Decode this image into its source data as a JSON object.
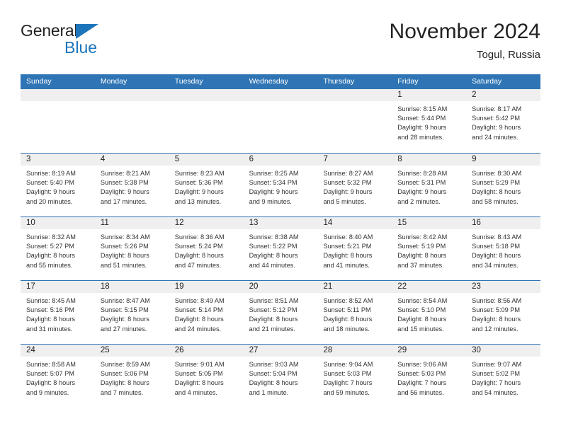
{
  "brand": {
    "name_part1": "General",
    "name_part2": "Blue",
    "mark": "triangle-icon"
  },
  "header": {
    "title": "November 2024",
    "subtitle": "Togul, Russia"
  },
  "calendar": {
    "weekday_headers": [
      "Sunday",
      "Monday",
      "Tuesday",
      "Wednesday",
      "Thursday",
      "Friday",
      "Saturday"
    ],
    "colors": {
      "header_blue": "#2f75b5",
      "day_band_gray": "#efefef",
      "text": "#333333"
    },
    "weeks": [
      [
        {
          "day": "",
          "sunrise": "",
          "sunset": "",
          "daylight_line1": "",
          "daylight_line2": ""
        },
        {
          "day": "",
          "sunrise": "",
          "sunset": "",
          "daylight_line1": "",
          "daylight_line2": ""
        },
        {
          "day": "",
          "sunrise": "",
          "sunset": "",
          "daylight_line1": "",
          "daylight_line2": ""
        },
        {
          "day": "",
          "sunrise": "",
          "sunset": "",
          "daylight_line1": "",
          "daylight_line2": ""
        },
        {
          "day": "",
          "sunrise": "",
          "sunset": "",
          "daylight_line1": "",
          "daylight_line2": ""
        },
        {
          "day": "1",
          "sunrise": "Sunrise: 8:15 AM",
          "sunset": "Sunset: 5:44 PM",
          "daylight_line1": "Daylight: 9 hours",
          "daylight_line2": "and 28 minutes."
        },
        {
          "day": "2",
          "sunrise": "Sunrise: 8:17 AM",
          "sunset": "Sunset: 5:42 PM",
          "daylight_line1": "Daylight: 9 hours",
          "daylight_line2": "and 24 minutes."
        }
      ],
      [
        {
          "day": "3",
          "sunrise": "Sunrise: 8:19 AM",
          "sunset": "Sunset: 5:40 PM",
          "daylight_line1": "Daylight: 9 hours",
          "daylight_line2": "and 20 minutes."
        },
        {
          "day": "4",
          "sunrise": "Sunrise: 8:21 AM",
          "sunset": "Sunset: 5:38 PM",
          "daylight_line1": "Daylight: 9 hours",
          "daylight_line2": "and 17 minutes."
        },
        {
          "day": "5",
          "sunrise": "Sunrise: 8:23 AM",
          "sunset": "Sunset: 5:36 PM",
          "daylight_line1": "Daylight: 9 hours",
          "daylight_line2": "and 13 minutes."
        },
        {
          "day": "6",
          "sunrise": "Sunrise: 8:25 AM",
          "sunset": "Sunset: 5:34 PM",
          "daylight_line1": "Daylight: 9 hours",
          "daylight_line2": "and 9 minutes."
        },
        {
          "day": "7",
          "sunrise": "Sunrise: 8:27 AM",
          "sunset": "Sunset: 5:32 PM",
          "daylight_line1": "Daylight: 9 hours",
          "daylight_line2": "and 5 minutes."
        },
        {
          "day": "8",
          "sunrise": "Sunrise: 8:28 AM",
          "sunset": "Sunset: 5:31 PM",
          "daylight_line1": "Daylight: 9 hours",
          "daylight_line2": "and 2 minutes."
        },
        {
          "day": "9",
          "sunrise": "Sunrise: 8:30 AM",
          "sunset": "Sunset: 5:29 PM",
          "daylight_line1": "Daylight: 8 hours",
          "daylight_line2": "and 58 minutes."
        }
      ],
      [
        {
          "day": "10",
          "sunrise": "Sunrise: 8:32 AM",
          "sunset": "Sunset: 5:27 PM",
          "daylight_line1": "Daylight: 8 hours",
          "daylight_line2": "and 55 minutes."
        },
        {
          "day": "11",
          "sunrise": "Sunrise: 8:34 AM",
          "sunset": "Sunset: 5:26 PM",
          "daylight_line1": "Daylight: 8 hours",
          "daylight_line2": "and 51 minutes."
        },
        {
          "day": "12",
          "sunrise": "Sunrise: 8:36 AM",
          "sunset": "Sunset: 5:24 PM",
          "daylight_line1": "Daylight: 8 hours",
          "daylight_line2": "and 47 minutes."
        },
        {
          "day": "13",
          "sunrise": "Sunrise: 8:38 AM",
          "sunset": "Sunset: 5:22 PM",
          "daylight_line1": "Daylight: 8 hours",
          "daylight_line2": "and 44 minutes."
        },
        {
          "day": "14",
          "sunrise": "Sunrise: 8:40 AM",
          "sunset": "Sunset: 5:21 PM",
          "daylight_line1": "Daylight: 8 hours",
          "daylight_line2": "and 41 minutes."
        },
        {
          "day": "15",
          "sunrise": "Sunrise: 8:42 AM",
          "sunset": "Sunset: 5:19 PM",
          "daylight_line1": "Daylight: 8 hours",
          "daylight_line2": "and 37 minutes."
        },
        {
          "day": "16",
          "sunrise": "Sunrise: 8:43 AM",
          "sunset": "Sunset: 5:18 PM",
          "daylight_line1": "Daylight: 8 hours",
          "daylight_line2": "and 34 minutes."
        }
      ],
      [
        {
          "day": "17",
          "sunrise": "Sunrise: 8:45 AM",
          "sunset": "Sunset: 5:16 PM",
          "daylight_line1": "Daylight: 8 hours",
          "daylight_line2": "and 31 minutes."
        },
        {
          "day": "18",
          "sunrise": "Sunrise: 8:47 AM",
          "sunset": "Sunset: 5:15 PM",
          "daylight_line1": "Daylight: 8 hours",
          "daylight_line2": "and 27 minutes."
        },
        {
          "day": "19",
          "sunrise": "Sunrise: 8:49 AM",
          "sunset": "Sunset: 5:14 PM",
          "daylight_line1": "Daylight: 8 hours",
          "daylight_line2": "and 24 minutes."
        },
        {
          "day": "20",
          "sunrise": "Sunrise: 8:51 AM",
          "sunset": "Sunset: 5:12 PM",
          "daylight_line1": "Daylight: 8 hours",
          "daylight_line2": "and 21 minutes."
        },
        {
          "day": "21",
          "sunrise": "Sunrise: 8:52 AM",
          "sunset": "Sunset: 5:11 PM",
          "daylight_line1": "Daylight: 8 hours",
          "daylight_line2": "and 18 minutes."
        },
        {
          "day": "22",
          "sunrise": "Sunrise: 8:54 AM",
          "sunset": "Sunset: 5:10 PM",
          "daylight_line1": "Daylight: 8 hours",
          "daylight_line2": "and 15 minutes."
        },
        {
          "day": "23",
          "sunrise": "Sunrise: 8:56 AM",
          "sunset": "Sunset: 5:09 PM",
          "daylight_line1": "Daylight: 8 hours",
          "daylight_line2": "and 12 minutes."
        }
      ],
      [
        {
          "day": "24",
          "sunrise": "Sunrise: 8:58 AM",
          "sunset": "Sunset: 5:07 PM",
          "daylight_line1": "Daylight: 8 hours",
          "daylight_line2": "and 9 minutes."
        },
        {
          "day": "25",
          "sunrise": "Sunrise: 8:59 AM",
          "sunset": "Sunset: 5:06 PM",
          "daylight_line1": "Daylight: 8 hours",
          "daylight_line2": "and 7 minutes."
        },
        {
          "day": "26",
          "sunrise": "Sunrise: 9:01 AM",
          "sunset": "Sunset: 5:05 PM",
          "daylight_line1": "Daylight: 8 hours",
          "daylight_line2": "and 4 minutes."
        },
        {
          "day": "27",
          "sunrise": "Sunrise: 9:03 AM",
          "sunset": "Sunset: 5:04 PM",
          "daylight_line1": "Daylight: 8 hours",
          "daylight_line2": "and 1 minute."
        },
        {
          "day": "28",
          "sunrise": "Sunrise: 9:04 AM",
          "sunset": "Sunset: 5:03 PM",
          "daylight_line1": "Daylight: 7 hours",
          "daylight_line2": "and 59 minutes."
        },
        {
          "day": "29",
          "sunrise": "Sunrise: 9:06 AM",
          "sunset": "Sunset: 5:03 PM",
          "daylight_line1": "Daylight: 7 hours",
          "daylight_line2": "and 56 minutes."
        },
        {
          "day": "30",
          "sunrise": "Sunrise: 9:07 AM",
          "sunset": "Sunset: 5:02 PM",
          "daylight_line1": "Daylight: 7 hours",
          "daylight_line2": "and 54 minutes."
        }
      ]
    ]
  }
}
